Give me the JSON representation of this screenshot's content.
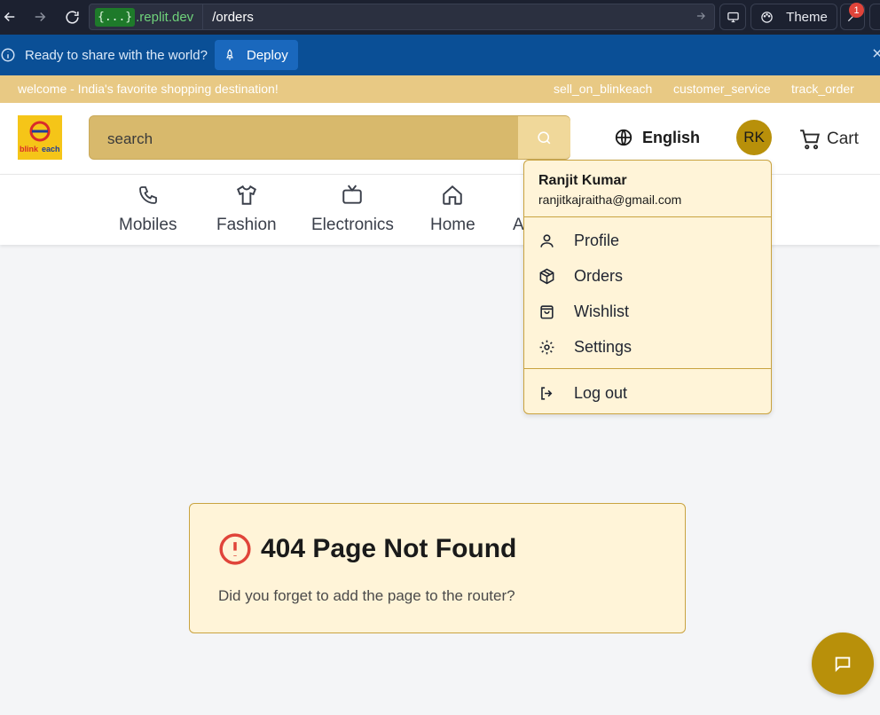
{
  "browser": {
    "url_tag": "{...}",
    "url_host": ".replit.dev",
    "url_path": "/orders",
    "theme_label": "Theme",
    "notification_count": "1"
  },
  "deploy_bar": {
    "message": "Ready to share with the world?",
    "deploy_label": "Deploy"
  },
  "top_strip": {
    "welcome": "welcome - India's favorite shopping destination!",
    "links": [
      "sell_on_blinkeach",
      "customer_service",
      "track_order"
    ]
  },
  "header": {
    "logo_text": "blinkeach",
    "search_placeholder": "search",
    "language": "English",
    "avatar_initials": "RK",
    "cart_label": "Cart"
  },
  "categories": [
    {
      "label": "Mobiles",
      "icon": "phone-icon"
    },
    {
      "label": "Fashion",
      "icon": "shirt-icon"
    },
    {
      "label": "Electronics",
      "icon": "tv-icon"
    },
    {
      "label": "Home",
      "icon": "home-icon"
    },
    {
      "label": "A",
      "icon": "appliance-icon"
    }
  ],
  "user_menu": {
    "name": "Ranjit Kumar",
    "email": "ranjitkajraitha@gmail.com",
    "items": [
      {
        "label": "Profile",
        "icon": "user-icon"
      },
      {
        "label": "Orders",
        "icon": "package-icon"
      },
      {
        "label": "Wishlist",
        "icon": "shopping-bag-icon"
      },
      {
        "label": "Settings",
        "icon": "gear-icon"
      }
    ],
    "logout_label": "Log out"
  },
  "not_found": {
    "title": "404 Page Not Found",
    "message": "Did you forget to add the page to the router?"
  },
  "colors": {
    "brand_gold": "#b8900a",
    "deploy_blue": "#0a4f96",
    "panel_cream": "#fff4d8",
    "error_red": "#e0443a"
  }
}
